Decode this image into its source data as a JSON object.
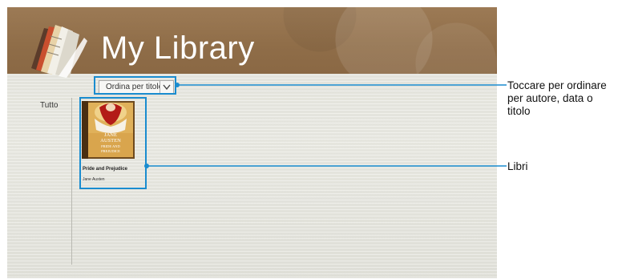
{
  "header": {
    "title": "My Library"
  },
  "toolbar": {
    "sort_label": "Ordina per titolo"
  },
  "sidebar": {
    "category": "Tutto"
  },
  "books": [
    {
      "title": "Pride and Prejudice",
      "author": "Jane Austen",
      "cover_text_1": "JANE",
      "cover_text_2": "AUSTEN",
      "cover_text_3": "PRIDE AND",
      "cover_text_4": "PREJUDICE"
    }
  ],
  "annotations": {
    "sort_callout": [
      "Toccare per ordinare",
      "per autore, data o",
      "titolo"
    ],
    "books_callout": "Libri"
  },
  "colors": {
    "header": "#8f6d48",
    "callout": "#1a8ccf"
  }
}
